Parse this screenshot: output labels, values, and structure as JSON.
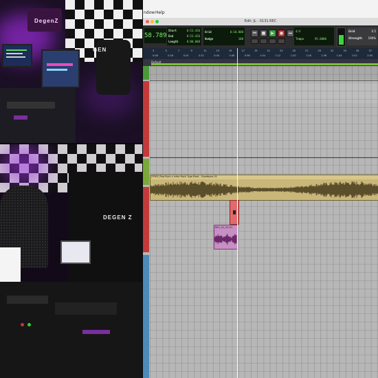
{
  "menu": {
    "window_label": "ndow",
    "help_label": "Help"
  },
  "window": {
    "title": "Edit: JL - 0131 REC"
  },
  "counter": {
    "main": "58.789"
  },
  "selection": {
    "start_label": "Start",
    "start_value": "0:53.426",
    "end_label": "End",
    "end_value": "0:53.426",
    "length_label": "Length",
    "length_value": "0:00.000"
  },
  "nudge": {
    "grid_label": "Grid",
    "grid_value": "0:10.000",
    "nudge_label": "Nudge",
    "nudge_value": "100"
  },
  "transport": {
    "rewind_icon": "⏮",
    "stop_icon": "■",
    "play_icon": "▶",
    "record_icon": "●",
    "ff_icon": "⏭",
    "loop_icon": "↻"
  },
  "tempo": {
    "label": "Tempo",
    "value": "95.0000",
    "meter_value": "4/4"
  },
  "grid_panel": {
    "label": "Grid",
    "value": "0.5",
    "strength_label": "Strength",
    "strength_value": "100%"
  },
  "rulers": {
    "bar_labels": [
      "3",
      "5",
      "7",
      "9",
      "11",
      "13",
      "15",
      "17",
      "19",
      "21",
      "23",
      "25",
      "27",
      "29",
      "31",
      "33",
      "35",
      "37"
    ],
    "time_labels": [
      "0:08",
      "0:16",
      "0:24",
      "0:32",
      "0:40",
      "0:48",
      "0:56",
      "1:04",
      "1:12",
      "1:20",
      "1:28",
      "1:36",
      "1:44",
      "1:52",
      "2:00"
    ]
  },
  "marker": {
    "label": "Default"
  },
  "tracks": {
    "beat_clip_name": "[FREE] Pop Rock x Indie Rock Type Beat - Goodbyes-01",
    "vocal_clip_name": "REC_01_03-01",
    "small_clip_name": "A"
  },
  "colors": {
    "beat_clip": "#c9b77a",
    "beat_clip_header": "#d8c78a",
    "waveform": "#5b4e2a",
    "vocal_clip": "#c690c4",
    "red_clip": "#e06a6a",
    "toolbar_lcd": "#7ef06a"
  }
}
